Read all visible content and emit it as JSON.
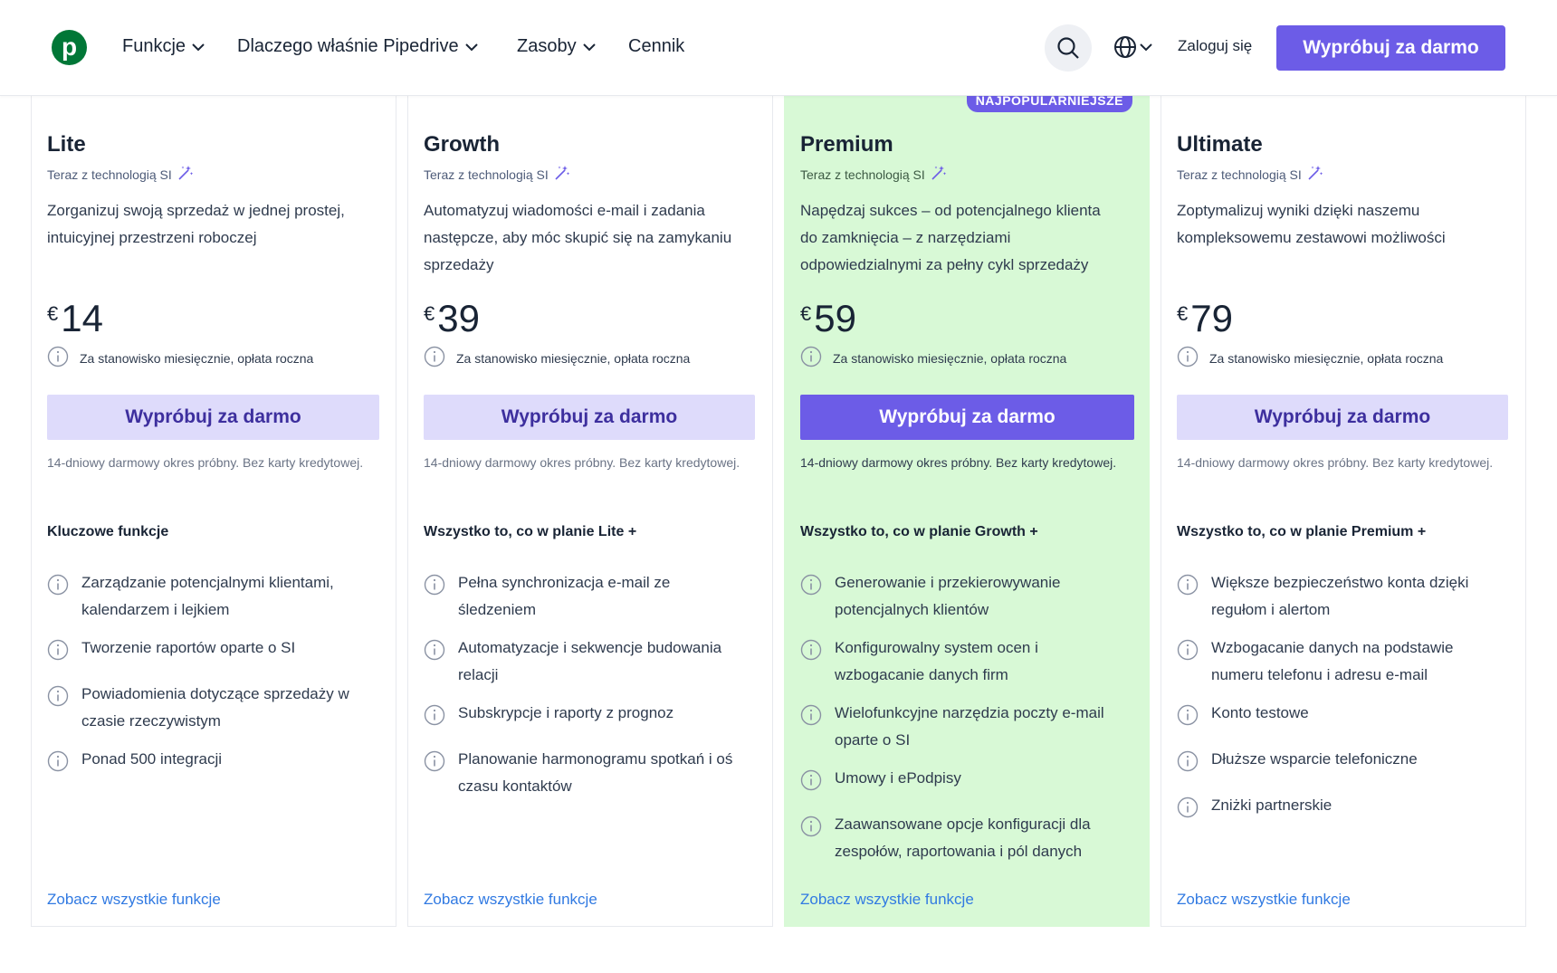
{
  "header": {
    "logo_letter": "p",
    "nav": [
      {
        "label": "Funkcje",
        "has_dropdown": true
      },
      {
        "label": "Dlaczego właśnie Pipedrive",
        "has_dropdown": true
      },
      {
        "label": "Zasoby",
        "has_dropdown": true
      },
      {
        "label": "Cennik",
        "has_dropdown": false
      }
    ],
    "search_icon": "search-icon",
    "language_icon": "globe-icon",
    "login_label": "Zaloguj się",
    "cta_label": "Wypróbuj za darmo"
  },
  "colors": {
    "brand_green": "#017737",
    "accent_purple": "#6c5ce7",
    "featured_bg": "#d8f9d6",
    "light_button": "#dedbfb",
    "link": "#317ae2"
  },
  "plans": [
    {
      "name": "Lite",
      "ai_tag": "Teraz z technologią SI",
      "description": "Zorganizuj swoją sprzedaż w jednej prostej, intuicyjnej przestrzeni roboczej",
      "currency": "€",
      "price": "14",
      "billing": "Za stanowisko miesięcznie, opłata roczna",
      "cta": "Wypróbuj za darmo",
      "trial": "14-dniowy darmowy okres próbny. Bez karty kredytowej.",
      "features_heading": "Kluczowe funkcje",
      "features": [
        "Zarządzanie potencjalnymi klientami, kalendarzem i lejkiem",
        "Tworzenie raportów oparte o SI",
        "Powiadomienia dotyczące sprzedaży w czasie rzeczywistym",
        "Ponad 500 integracji"
      ],
      "see_all": "Zobacz wszystkie funkcje"
    },
    {
      "name": "Growth",
      "ai_tag": "Teraz z technologią SI",
      "description": "Automatyzuj wiadomości e-mail i zadania następcze, aby móc skupić się na zamykaniu sprzedaży",
      "currency": "€",
      "price": "39",
      "billing": "Za stanowisko miesięcznie, opłata roczna",
      "cta": "Wypróbuj za darmo",
      "trial": "14-dniowy darmowy okres próbny. Bez karty kredytowej.",
      "features_heading": "Wszystko to, co w planie Lite +",
      "features": [
        "Pełna synchronizacja e-mail ze śledzeniem",
        "Automatyzacje i sekwencje budowania relacji",
        "Subskrypcje i raporty z prognoz",
        "Planowanie harmonogramu spotkań i oś czasu kontaktów"
      ],
      "see_all": "Zobacz wszystkie funkcje"
    },
    {
      "name": "Premium",
      "ai_tag": "Teraz z technologią SI",
      "description": "Napędzaj sukces – od potencjalnego klienta do zamknięcia – z narzędziami odpowiedzialnymi za pełny cykl sprzedaży",
      "currency": "€",
      "price": "59",
      "billing": "Za stanowisko miesięcznie, opłata roczna",
      "cta": "Wypróbuj za darmo",
      "trial": "14-dniowy darmowy okres próbny. Bez karty kredytowej.",
      "features_heading": "Wszystko to, co w planie Growth +",
      "features": [
        "Generowanie i przekierowywanie potencjalnych klientów",
        "Konfigurowalny system ocen i wzbogacanie danych firm",
        "Wielofunkcyjne narzędzia poczty e-mail oparte o SI",
        "Umowy i ePodpisy",
        "Zaawansowane opcje konfiguracji dla zespołów, raportowania i pól danych"
      ],
      "see_all": "Zobacz wszystkie funkcje",
      "badge": "NAJPOPULARNIEJSZE"
    },
    {
      "name": "Ultimate",
      "ai_tag": "Teraz z technologią SI",
      "description": "Zoptymalizuj wyniki dzięki naszemu kompleksowemu zestawowi możliwości",
      "currency": "€",
      "price": "79",
      "billing": "Za stanowisko miesięcznie, opłata roczna",
      "cta": "Wypróbuj za darmo",
      "trial": "14-dniowy darmowy okres próbny. Bez karty kredytowej.",
      "features_heading": "Wszystko to, co w planie Premium +",
      "features": [
        "Większe bezpieczeństwo konta dzięki regułom i alertom",
        "Wzbogacanie danych na podstawie numeru telefonu i adresu e-mail",
        "Konto testowe",
        "Dłuższe wsparcie telefoniczne",
        "Zniżki partnerskie"
      ],
      "see_all": "Zobacz wszystkie funkcje"
    }
  ]
}
